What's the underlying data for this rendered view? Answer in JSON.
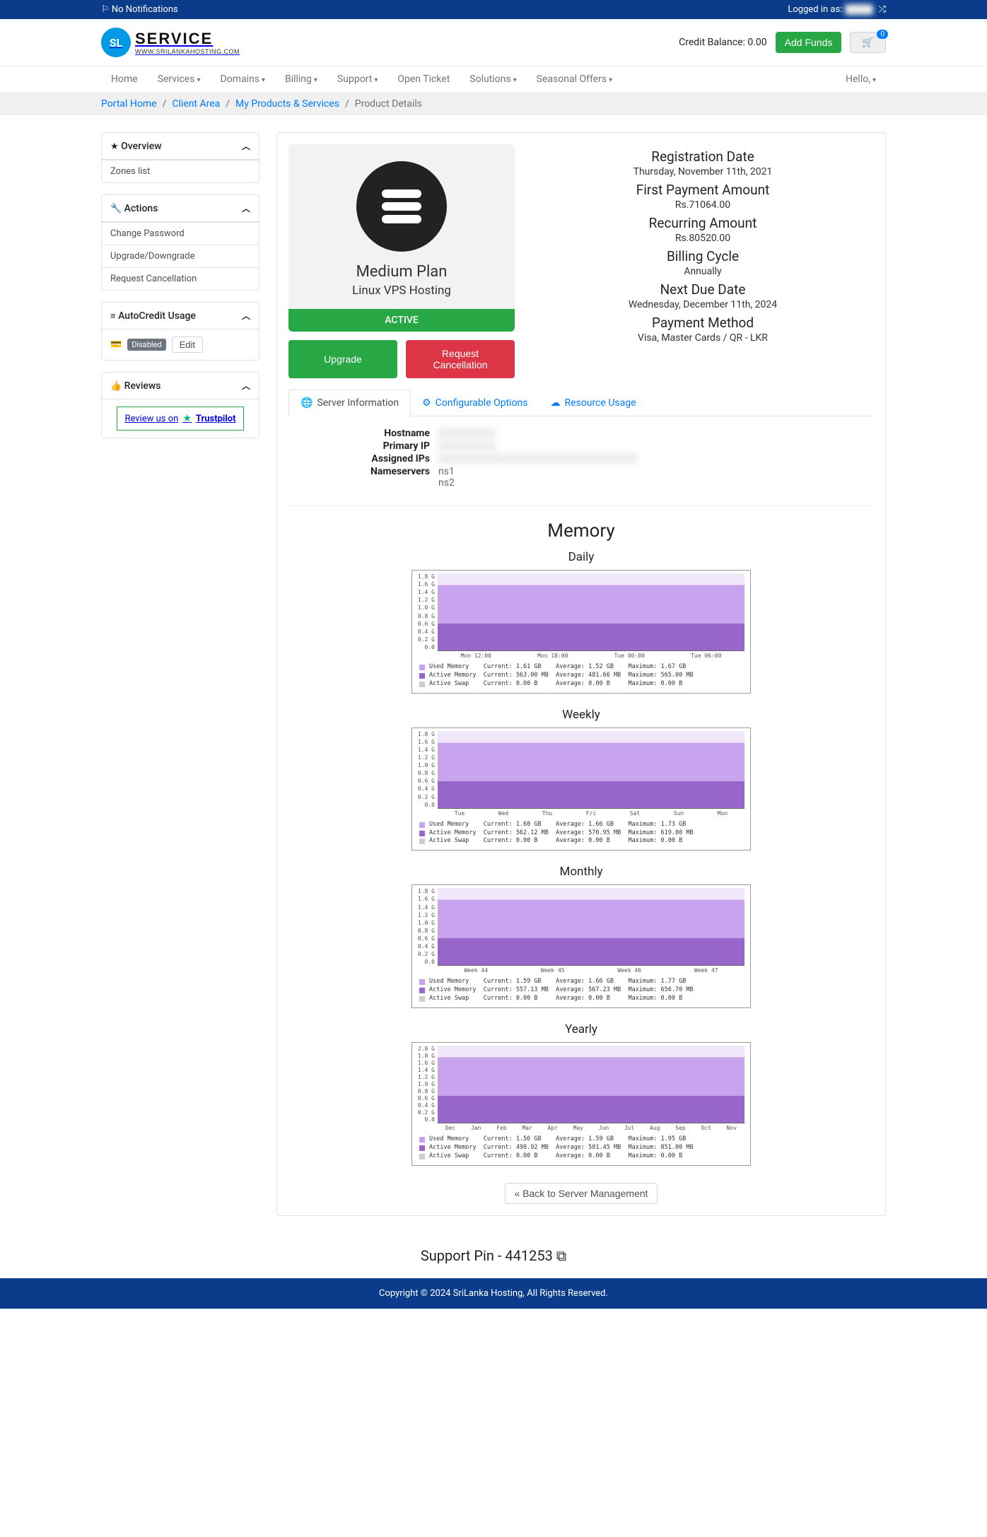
{
  "topbar": {
    "notifications": "No Notifications",
    "logged_in": "Logged in as:",
    "user_masked": "      "
  },
  "logo": {
    "service": "SERVICE",
    "sub": "WWW.SRILANKAHOSTING.COM",
    "badge": "SL"
  },
  "header": {
    "credit_label": "Credit Balance: 0.00",
    "add_funds": "Add Funds",
    "cart_count": "0"
  },
  "nav": {
    "home": "Home",
    "services": "Services",
    "domains": "Domains",
    "billing": "Billing",
    "support": "Support",
    "open_ticket": "Open Ticket",
    "solutions": "Solutions",
    "seasonal": "Seasonal Offers",
    "hello": "Hello,"
  },
  "breadcrumb": {
    "portal_home": "Portal Home",
    "client_area": "Client Area",
    "my_products": "My Products & Services",
    "product_details": "Product Details"
  },
  "sidebar": {
    "overview": {
      "title": "Overview",
      "zones": "Zones list"
    },
    "actions": {
      "title": "Actions",
      "change_password": "Change Password",
      "upgrade_downgrade": "Upgrade/Downgrade",
      "request_cancellation": "Request Cancellation"
    },
    "autocredit": {
      "title": "AutoCredit Usage",
      "disabled": "Disabled",
      "edit": "Edit"
    },
    "reviews": {
      "title": "Reviews",
      "trustpilot_text": "Review us on",
      "trustpilot_brand": "Trustpilot"
    }
  },
  "product": {
    "plan_name": "Medium Plan",
    "plan_type": "Linux VPS Hosting",
    "status": "ACTIVE",
    "upgrade_btn": "Upgrade",
    "cancel_btn": "Request Cancellation"
  },
  "details": {
    "reg_date_label": "Registration Date",
    "reg_date": "Thursday, November 11th, 2021",
    "first_payment_label": "First Payment Amount",
    "first_payment": "Rs.71064.00",
    "recurring_label": "Recurring Amount",
    "recurring": "Rs.80520.00",
    "billing_cycle_label": "Billing Cycle",
    "billing_cycle": "Annually",
    "next_due_label": "Next Due Date",
    "next_due": "Wednesday, December 11th, 2024",
    "payment_method_label": "Payment Method",
    "payment_method": "Visa, Master Cards / QR - LKR"
  },
  "tabs": {
    "server_info": "Server Information",
    "config_options": "Configurable Options",
    "resource_usage": "Resource Usage"
  },
  "server_info": {
    "hostname_label": "Hostname",
    "primary_ip_label": "Primary IP",
    "assigned_ips_label": "Assigned IPs",
    "nameservers_label": "Nameservers",
    "ns1": "ns1",
    "ns2": "ns2"
  },
  "memory": {
    "heading": "Memory",
    "charts": [
      {
        "title": "Daily",
        "y_ticks": [
          "1.8 G",
          "1.6 G",
          "1.4 G",
          "1.2 G",
          "1.0 G",
          "0.8 G",
          "0.6 G",
          "0.4 G",
          "0.2 G",
          "0.0"
        ],
        "x_ticks": [
          "Mon 12:00",
          "Mon 18:00",
          "Tue 00:00",
          "Tue 06:00"
        ],
        "legend": [
          {
            "name": "Used Memory",
            "current": "1.61 GB",
            "average": "1.52 GB",
            "maximum": "1.67 GB"
          },
          {
            "name": "Active Memory",
            "current": "563.00 MB",
            "average": "481.66 MB",
            "maximum": "565.00 MB"
          },
          {
            "name": "Active Swap",
            "current": "0.00 B",
            "average": "0.00 B",
            "maximum": "0.00 B"
          }
        ]
      },
      {
        "title": "Weekly",
        "y_ticks": [
          "1.8 G",
          "1.6 G",
          "1.4 G",
          "1.2 G",
          "1.0 G",
          "0.8 G",
          "0.6 G",
          "0.4 G",
          "0.2 G",
          "0.0"
        ],
        "x_ticks": [
          "Tue",
          "Wed",
          "Thu",
          "Fri",
          "Sat",
          "Sun",
          "Mon"
        ],
        "legend": [
          {
            "name": "Used Memory",
            "current": "1.60 GB",
            "average": "1.66 GB",
            "maximum": "1.73 GB"
          },
          {
            "name": "Active Memory",
            "current": "562.12 MB",
            "average": "570.95 MB",
            "maximum": "619.00 MB"
          },
          {
            "name": "Active Swap",
            "current": "0.00 B",
            "average": "0.00 B",
            "maximum": "0.00 B"
          }
        ]
      },
      {
        "title": "Monthly",
        "y_ticks": [
          "1.8 G",
          "1.6 G",
          "1.4 G",
          "1.2 G",
          "1.0 G",
          "0.8 G",
          "0.6 G",
          "0.4 G",
          "0.2 G",
          "0.0"
        ],
        "x_ticks": [
          "Week 44",
          "Week 45",
          "Week 46",
          "Week 47"
        ],
        "legend": [
          {
            "name": "Used Memory",
            "current": "1.59 GB",
            "average": "1.66 GB",
            "maximum": "1.77 GB"
          },
          {
            "name": "Active Memory",
            "current": "557.13 MB",
            "average": "567.23 MB",
            "maximum": "656.70 MB"
          },
          {
            "name": "Active Swap",
            "current": "0.00 B",
            "average": "0.00 B",
            "maximum": "0.00 B"
          }
        ]
      },
      {
        "title": "Yearly",
        "y_ticks": [
          "2.0 G",
          "1.8 G",
          "1.6 G",
          "1.4 G",
          "1.2 G",
          "1.0 G",
          "0.8 G",
          "0.6 G",
          "0.4 G",
          "0.2 G",
          "0.0"
        ],
        "x_ticks": [
          "Dec",
          "Jan",
          "Feb",
          "Mar",
          "Apr",
          "May",
          "Jun",
          "Jul",
          "Aug",
          "Sep",
          "Oct",
          "Nov"
        ],
        "legend": [
          {
            "name": "Used Memory",
            "current": "1.56 GB",
            "average": "1.59 GB",
            "maximum": "1.95 GB"
          },
          {
            "name": "Active Memory",
            "current": "498.92 MB",
            "average": "501.45 MB",
            "maximum": "851.00 MB"
          },
          {
            "name": "Active Swap",
            "current": "0.00 B",
            "average": "0.00 B",
            "maximum": "0.00 B"
          }
        ]
      }
    ]
  },
  "back_btn": "« Back to Server Management",
  "support_pin": "Support Pin - 441253",
  "footer": "Copyright © 2024 SriLanka Hosting, All Rights Reserved."
}
